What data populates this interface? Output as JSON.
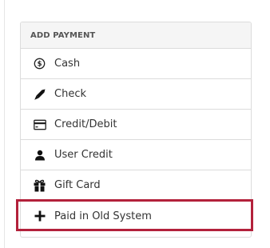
{
  "panel": {
    "header": "ADD PAYMENT",
    "options": [
      {
        "label": "Cash",
        "icon": "dollar-circle-icon"
      },
      {
        "label": "Check",
        "icon": "pen-icon"
      },
      {
        "label": "Credit/Debit",
        "icon": "credit-card-icon"
      },
      {
        "label": "User Credit",
        "icon": "user-icon"
      },
      {
        "label": "Gift Card",
        "icon": "gift-icon"
      },
      {
        "label": "Paid in Old System",
        "icon": "plus-icon"
      }
    ]
  },
  "colors": {
    "highlight": "#b3213b",
    "border": "#dcdcdc",
    "header_bg": "#f5f5f5"
  }
}
